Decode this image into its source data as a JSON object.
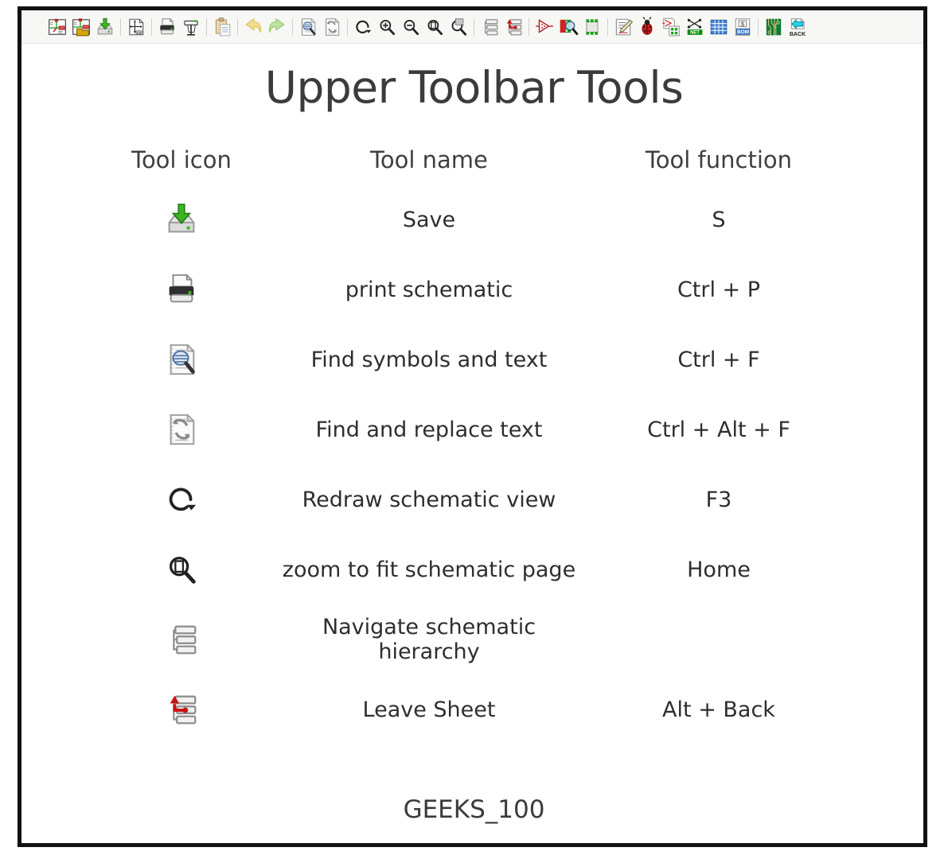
{
  "slide": {
    "title": "Upper Toolbar Tools",
    "footer": "GEEKS_100",
    "border_color": "#111111",
    "text_color": "#3b3b3b"
  },
  "toolbar": {
    "background": "#f7f7f5",
    "separator_color": "#cfcfcb",
    "items": [
      {
        "icon": "new-schematic-icon",
        "label": "New Schematic"
      },
      {
        "icon": "open-schematic-icon",
        "label": "Open Schematic"
      },
      {
        "icon": "save-schematic-icon",
        "label": "Save Schematic"
      },
      {
        "sep": true
      },
      {
        "icon": "page-settings-icon",
        "label": "Page Settings"
      },
      {
        "sep": true
      },
      {
        "icon": "print-icon",
        "label": "Print"
      },
      {
        "icon": "plot-icon",
        "label": "Plot"
      },
      {
        "sep": true
      },
      {
        "icon": "paste-icon",
        "label": "Paste"
      },
      {
        "sep": true
      },
      {
        "icon": "undo-icon",
        "label": "Undo"
      },
      {
        "icon": "redo-icon",
        "label": "Redo"
      },
      {
        "sep": true
      },
      {
        "icon": "find-icon",
        "label": "Find symbols and text"
      },
      {
        "icon": "find-replace-icon",
        "label": "Find and replace text"
      },
      {
        "sep": true
      },
      {
        "icon": "refresh-icon",
        "label": "Redraw schematic view"
      },
      {
        "icon": "zoom-in-icon",
        "label": "Zoom in"
      },
      {
        "icon": "zoom-out-icon",
        "label": "Zoom out"
      },
      {
        "icon": "zoom-fit-icon",
        "label": "Zoom to fit schematic page"
      },
      {
        "icon": "zoom-area-icon",
        "label": "Zoom to selection"
      },
      {
        "sep": true
      },
      {
        "icon": "hierarchy-icon",
        "label": "Navigate schematic hierarchy"
      },
      {
        "icon": "leave-sheet-icon",
        "label": "Leave Sheet"
      },
      {
        "sep": true
      },
      {
        "icon": "place-symbol-icon",
        "label": "Place symbol"
      },
      {
        "icon": "symbol-library-icon",
        "label": "Symbol library browser"
      },
      {
        "icon": "footprint-assign-icon",
        "label": "Assign footprints"
      },
      {
        "sep": true
      },
      {
        "icon": "schematic-editor-icon",
        "label": "Schematic editor"
      },
      {
        "icon": "erc-icon",
        "label": "Electrical rules checker"
      },
      {
        "icon": "annotate-icon",
        "label": "Annotate schematic"
      },
      {
        "icon": "netlist-icon",
        "label": "Generate netlist"
      },
      {
        "icon": "spreadsheet-icon",
        "label": "Fields table editor"
      },
      {
        "icon": "bom-icon",
        "label": "Generate bill of materials"
      },
      {
        "sep": true
      },
      {
        "icon": "pcb-editor-icon",
        "label": "PCB editor"
      },
      {
        "icon": "back-annotate-icon",
        "label": "BACK"
      }
    ]
  },
  "table": {
    "headers": {
      "icon": "Tool icon",
      "name": "Tool name",
      "function": "Tool function"
    },
    "rows": [
      {
        "icon": "save-schematic-icon",
        "name": "Save",
        "function": "S"
      },
      {
        "icon": "print-icon",
        "name": "print schematic",
        "function": "Ctrl + P"
      },
      {
        "icon": "find-icon",
        "name": "Find symbols and text",
        "function": "Ctrl + F"
      },
      {
        "icon": "find-replace-icon",
        "name": "Find and replace text",
        "function": "Ctrl + Alt + F"
      },
      {
        "icon": "refresh-icon",
        "name": "Redraw schematic view",
        "function": "F3"
      },
      {
        "icon": "zoom-fit-icon",
        "name": "zoom to fit schematic page",
        "function": "Home"
      },
      {
        "icon": "hierarchy-icon",
        "name": "Navigate schematic hierarchy",
        "function": ""
      },
      {
        "icon": "leave-sheet-icon",
        "name": "Leave Sheet",
        "function": "Alt + Back"
      }
    ]
  },
  "colors": {
    "green_accent": "#3cb521",
    "red_accent": "#cc2222",
    "blue_accent": "#4477bb",
    "cyan_accent": "#2ad1e8",
    "gray_icon": "#8a8a8a",
    "dark_text": "#2e2e2e"
  }
}
